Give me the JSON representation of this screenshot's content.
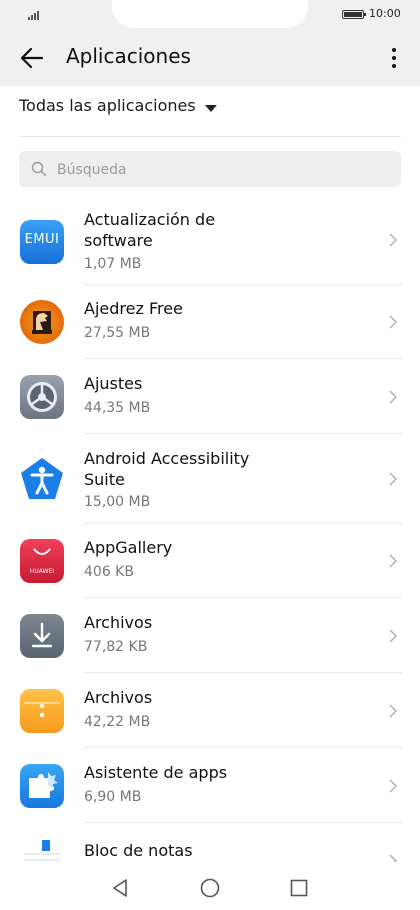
{
  "status": {
    "time": "10:00"
  },
  "header": {
    "title": "Aplicaciones"
  },
  "filter": {
    "label": "Todas las aplicaciones"
  },
  "search": {
    "placeholder": "Búsqueda"
  },
  "apps": [
    {
      "name": "Actualización de software",
      "size": "1,07 MB",
      "icon": "emui-update-icon"
    },
    {
      "name": "Ajedrez Free",
      "size": "27,55 MB",
      "icon": "chess-icon"
    },
    {
      "name": "Ajustes",
      "size": "44,35 MB",
      "icon": "settings-gear-icon"
    },
    {
      "name": "Android Accessibility Suite",
      "size": "15,00 MB",
      "icon": "accessibility-icon"
    },
    {
      "name": "AppGallery",
      "size": "406 KB",
      "icon": "appgallery-icon"
    },
    {
      "name": "Archivos",
      "size": "77,82 KB",
      "icon": "download-files-icon"
    },
    {
      "name": "Archivos",
      "size": "42,22 MB",
      "icon": "files-folder-icon"
    },
    {
      "name": "Asistente de apps",
      "size": "6,90 MB",
      "icon": "puzzle-icon"
    },
    {
      "name": "Bloc de notas",
      "size": "",
      "icon": "notepad-icon"
    }
  ],
  "icon_texts": {
    "emui": "EMUI",
    "huawei": "HUAWEI"
  },
  "colors": {
    "accent": "#1a7ee6",
    "appbar": "#f0f0f0",
    "secondary_text": "#777777"
  }
}
